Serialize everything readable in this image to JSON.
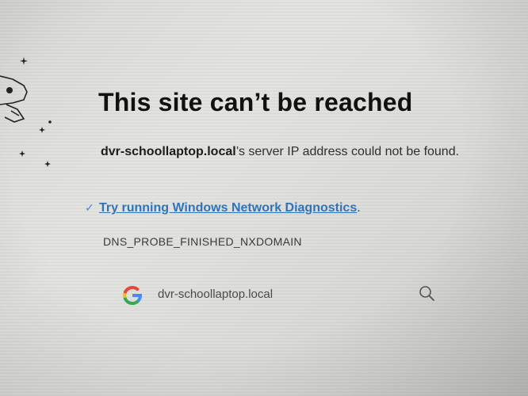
{
  "page": {
    "title": "This site can’t be reached",
    "message": {
      "host": "dvr-schoollaptop.local",
      "suffix": "’s server IP address could not be found."
    },
    "diagnostics": {
      "check_glyph": "✓",
      "link_label": "Try running Windows Network Diagnostics",
      "trailing_period": "."
    },
    "error_code": "DNS_PROBE_FINISHED_NXDOMAIN",
    "search": {
      "engine_icon": "google-icon",
      "query": "dvr-schoollaptop.local",
      "action_icon": "magnifier-icon"
    }
  },
  "colors": {
    "link": "#2f74bb",
    "title": "#111111",
    "body_text": "#2f2f2f"
  }
}
